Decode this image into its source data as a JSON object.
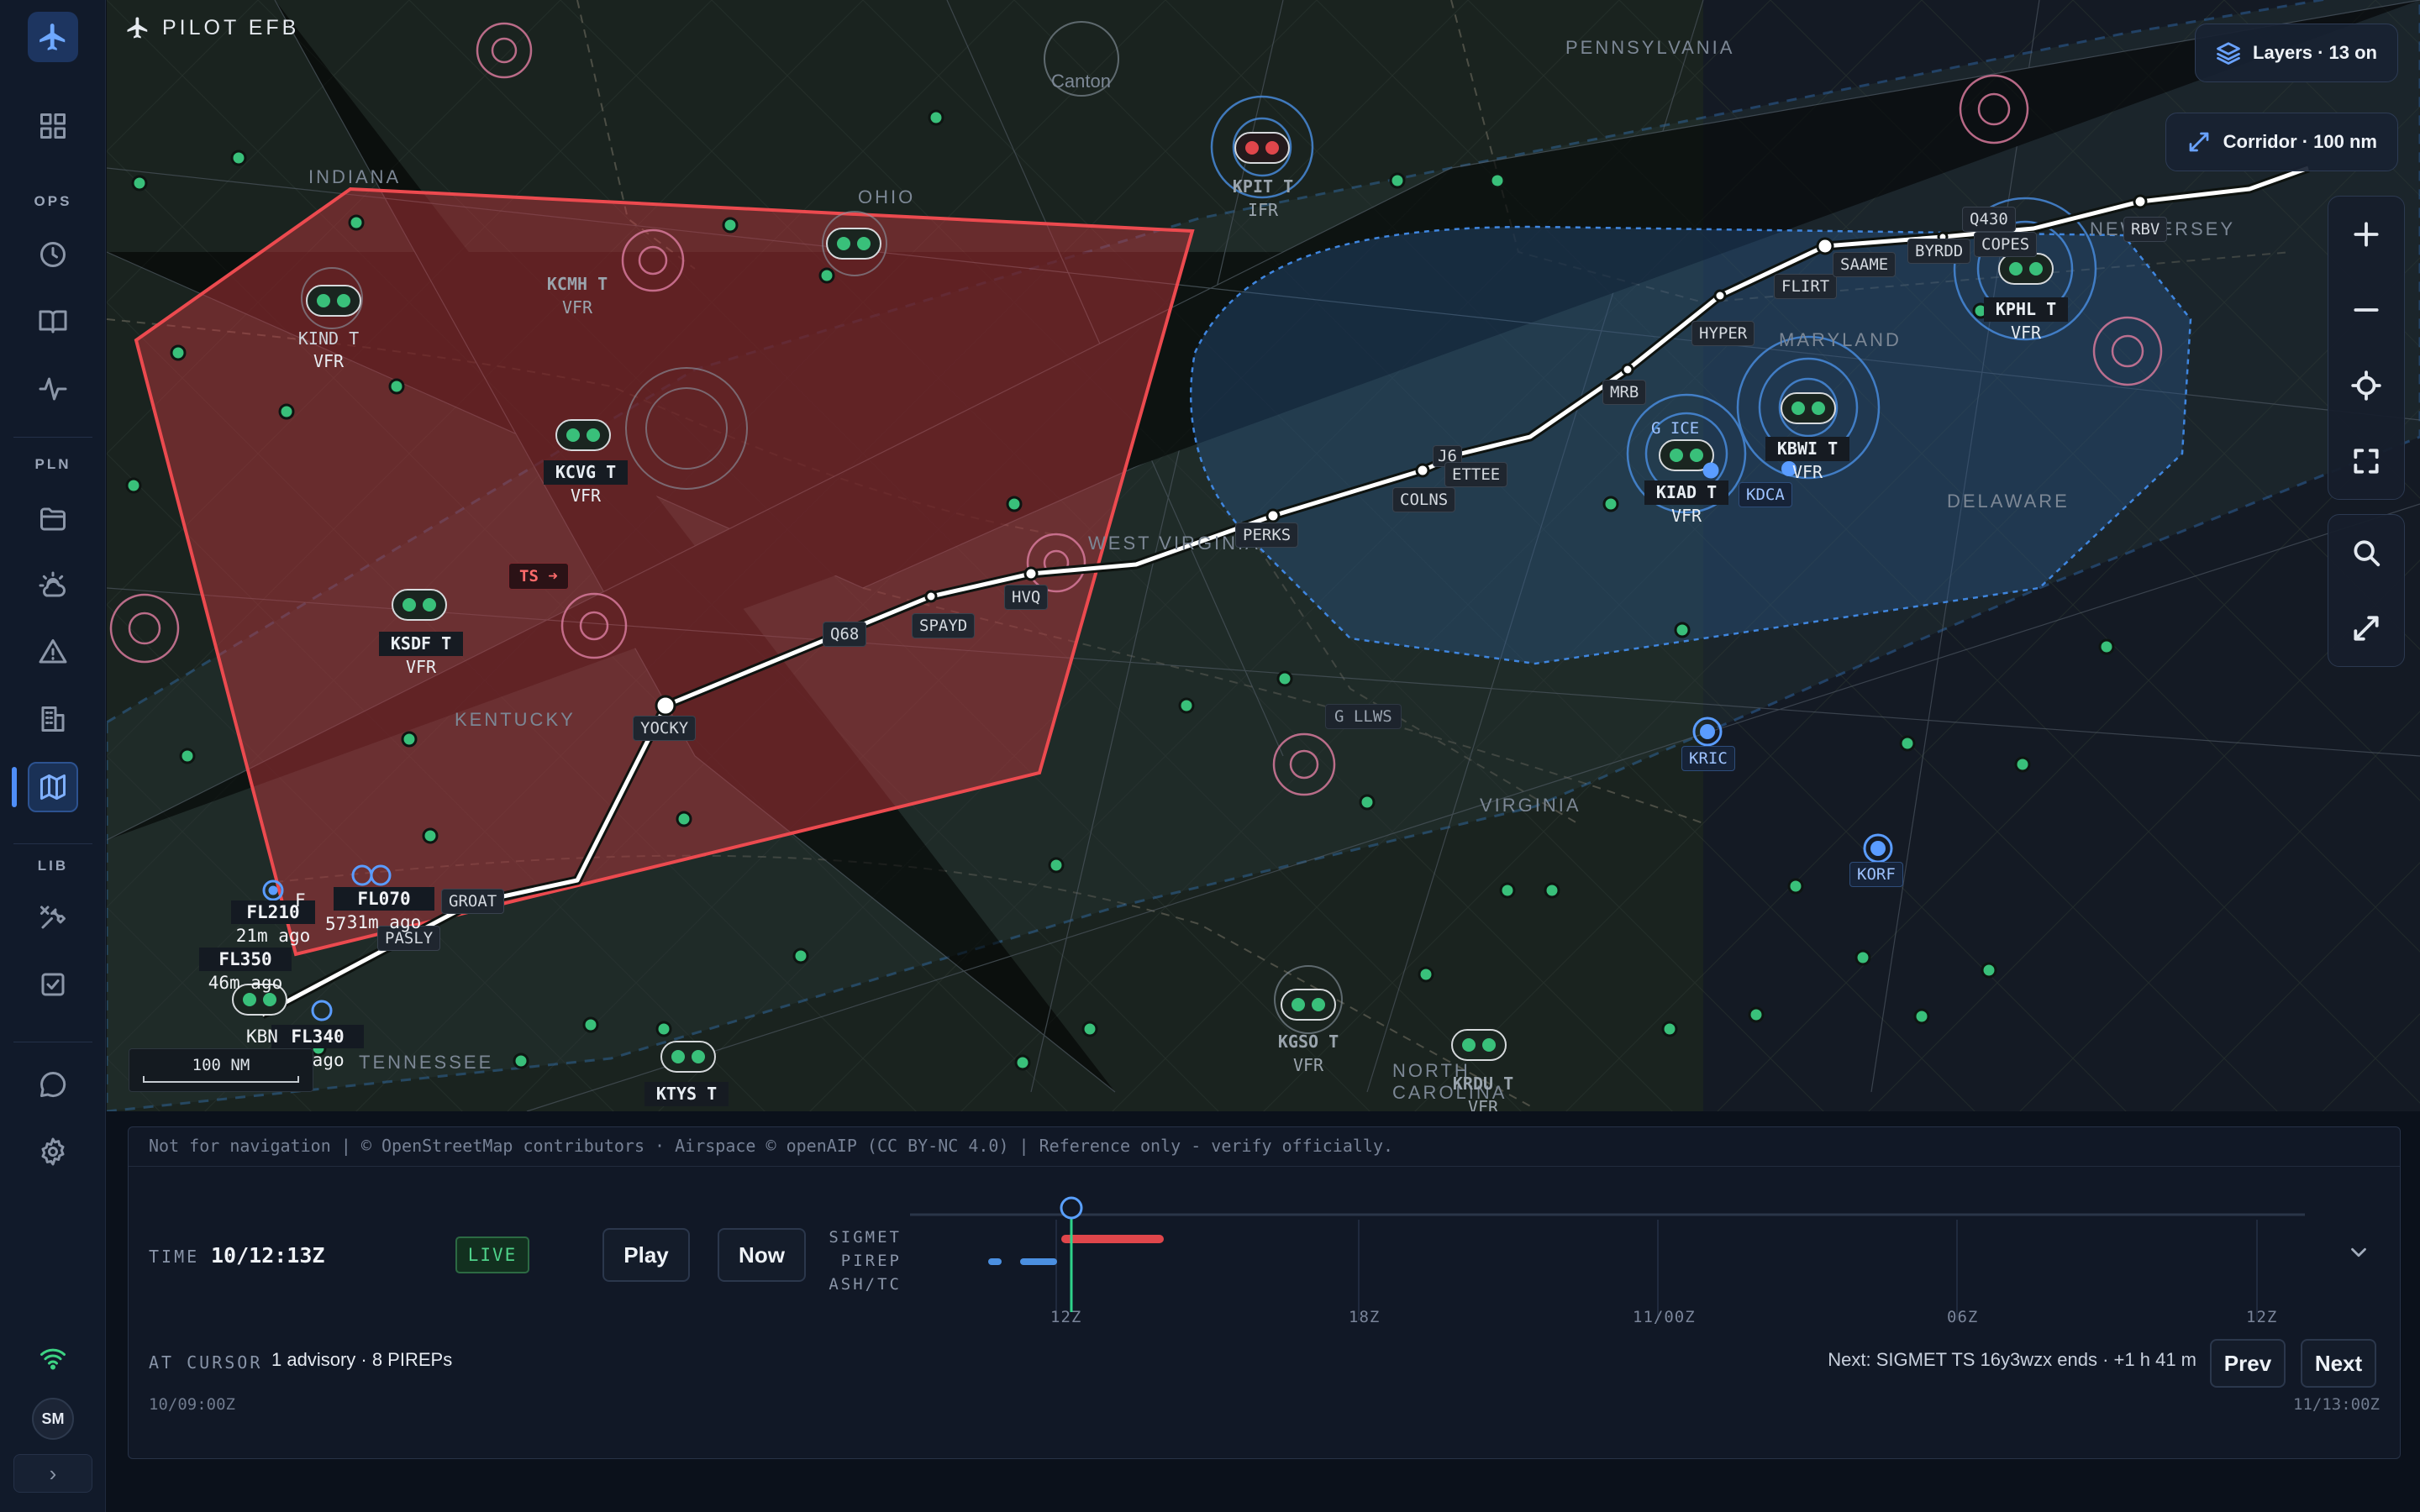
{
  "app": {
    "title": "PILOT EFB"
  },
  "sidebar": {
    "sections": [
      "OPS",
      "PLN",
      "LIB"
    ],
    "items": [
      {
        "name": "dashboard",
        "icon": "grid-icon"
      },
      {
        "name": "history",
        "icon": "clock-icon"
      },
      {
        "name": "logbook",
        "icon": "book-icon"
      },
      {
        "name": "performance",
        "icon": "pulse-icon"
      },
      {
        "name": "flight-plans",
        "icon": "folder-icon"
      },
      {
        "name": "weather",
        "icon": "cloud-sun-icon"
      },
      {
        "name": "notams",
        "icon": "warning-icon"
      },
      {
        "name": "airports",
        "icon": "building-icon"
      },
      {
        "name": "map",
        "icon": "map-icon",
        "active": true
      },
      {
        "name": "tools",
        "icon": "tools-icon"
      },
      {
        "name": "checklists",
        "icon": "checklist-icon"
      },
      {
        "name": "chat",
        "icon": "chat-icon"
      },
      {
        "name": "settings",
        "icon": "gear-icon"
      }
    ],
    "avatar": "SM",
    "expand": "›"
  },
  "map": {
    "layers_pill": "Layers · 13 on",
    "corridor_pill": "Corridor · 100 nm",
    "scale": "100 NM",
    "regions": [
      "INDIANA",
      "OHIO",
      "PENNSYLVANIA",
      "KENTUCKY",
      "WEST VIRGINIA",
      "VIRGINIA",
      "DELAWARE",
      "NEW JERSEY",
      "MARYLAND",
      "TENNESSEE",
      "NORTH CAROLINA"
    ],
    "cities": [
      "Canton"
    ],
    "route_waypoints": [
      "GROAT",
      "YOCKY",
      "Q68",
      "SPAYD",
      "HVQ",
      "PERKS",
      "COLNS",
      "J6",
      "ETTEE",
      "MRB",
      "HYPER",
      "FLIRT",
      "SAAME",
      "BYRDD",
      "Q430",
      "COPES",
      "RBV",
      "PASLY"
    ],
    "airports": [
      {
        "id": "KIND T",
        "cat": "VFR"
      },
      {
        "id": "KCMH T",
        "cat": "VFR"
      },
      {
        "id": "KPIT T",
        "cat": "IFR"
      },
      {
        "id": "KCVG T",
        "cat": "VFR"
      },
      {
        "id": "KSDF T",
        "cat": "VFR"
      },
      {
        "id": "KIAD T",
        "cat": "VFR"
      },
      {
        "id": "KBWI T",
        "cat": "VFR"
      },
      {
        "id": "KPHL T",
        "cat": "VFR"
      },
      {
        "id": "KGSO T",
        "cat": "VFR"
      },
      {
        "id": "KRDU T",
        "cat": "VFR"
      },
      {
        "id": "KTYS T",
        "cat": ""
      }
    ],
    "tagged_airports": [
      "KDCA",
      "KRIC",
      "KORF"
    ],
    "advisories": {
      "ts": "TS ➜",
      "ice": "G ICE",
      "llws": "G LLWS"
    },
    "pireps": [
      {
        "fl": "FL210",
        "age": "21m ago"
      },
      {
        "fl": "FL070",
        "age": "31m ago"
      },
      {
        "fl": "FL350",
        "age": "46m ago"
      },
      {
        "fl": "FL340",
        "age": "m ago"
      }
    ],
    "pirep_fragments": [
      "F",
      "57",
      "KBN"
    ]
  },
  "timeline": {
    "attribution": "Not for navigation  |  © OpenStreetMap contributors · Airspace © openAIP (CC BY-NC 4.0)  |  Reference only - verify officially.",
    "time_label": "TIME",
    "time_value": "10/12:13Z",
    "live": "LIVE",
    "play": "Play",
    "now": "Now",
    "rows": [
      "SIGMET",
      "PIREP",
      "ASH/TC"
    ],
    "ticks": [
      "12Z",
      "18Z",
      "11/00Z",
      "06Z",
      "12Z"
    ],
    "cursor_label": "AT CURSOR",
    "cursor_value": "1 advisory · 8 PIREPs",
    "next_text": "Next: SIGMET TS 16y3wzx ends · +1 h 41 m",
    "prev": "Prev",
    "next": "Next",
    "range_start": "10/09:00Z",
    "range_end": "11/13:00Z",
    "collapse_icon": "chevron-down-icon"
  },
  "colors": {
    "sigmet": "#e0464b",
    "advisory_blue": "#4b8fe0",
    "accent": "#4f8ef7",
    "vfr": "#39c07a",
    "route": "#ffffff"
  }
}
